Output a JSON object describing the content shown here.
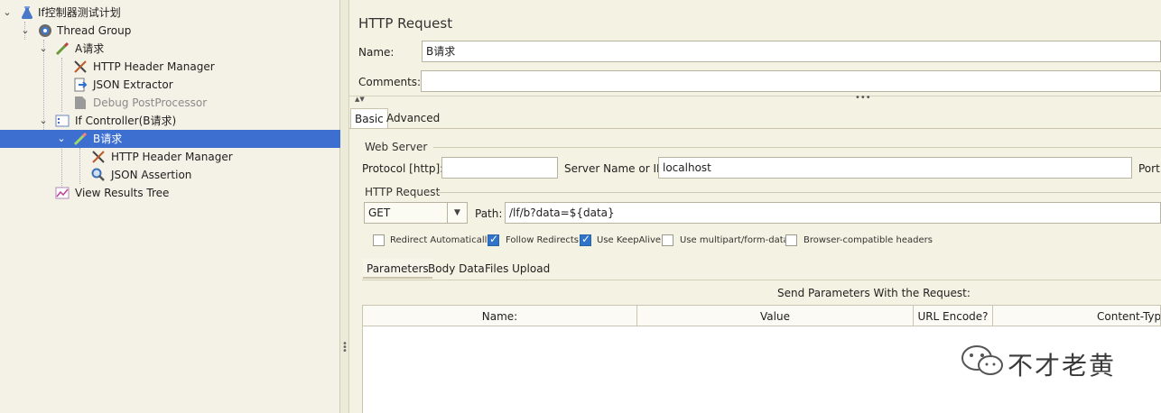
{
  "tree": {
    "items": [
      {
        "label": "If控制器测试计划",
        "icon": "flask-icon"
      },
      {
        "label": "Thread Group",
        "icon": "gear-icon"
      },
      {
        "label": "A请求",
        "icon": "pipette-icon"
      },
      {
        "label": "HTTP Header Manager",
        "icon": "tools-icon"
      },
      {
        "label": "JSON Extractor",
        "icon": "extractor-icon"
      },
      {
        "label": "Debug PostProcessor",
        "icon": "debug-icon"
      },
      {
        "label": "If Controller(B请求)",
        "icon": "controller-icon"
      },
      {
        "label": "B请求",
        "icon": "pipette-icon"
      },
      {
        "label": "HTTP Header Manager",
        "icon": "tools-icon"
      },
      {
        "label": "JSON Assertion",
        "icon": "magnifier-icon"
      },
      {
        "label": "View Results Tree",
        "icon": "chart-icon"
      }
    ]
  },
  "panel": {
    "title": "HTTP Request",
    "name_label": "Name:",
    "name_value": "B请求",
    "comments_label": "Comments:",
    "comments_value": "",
    "tabs": [
      "Basic",
      "Advanced"
    ],
    "web_server": {
      "group": "Web Server",
      "protocol_label": "Protocol [http]:",
      "protocol_value": "",
      "server_label": "Server Name or IP:",
      "server_value": "localhost",
      "port_label": "Port"
    },
    "http_request": {
      "group": "HTTP Request",
      "method": "GET",
      "path_label": "Path:",
      "path_value": "/lf/b?data=${data}"
    },
    "options": [
      {
        "label": "Redirect Automatically",
        "checked": false
      },
      {
        "label": "Follow Redirects",
        "checked": true
      },
      {
        "label": "Use KeepAlive",
        "checked": true
      },
      {
        "label": "Use multipart/form-data",
        "checked": false
      },
      {
        "label": "Browser-compatible headers",
        "checked": false
      }
    ],
    "sub_tabs": [
      "Parameters",
      "Body Data",
      "Files Upload"
    ],
    "send_params_label": "Send Parameters With the Request:",
    "columns": [
      "Name:",
      "Value",
      "URL Encode?",
      "Content-Type"
    ]
  },
  "watermark": "不才老黄"
}
